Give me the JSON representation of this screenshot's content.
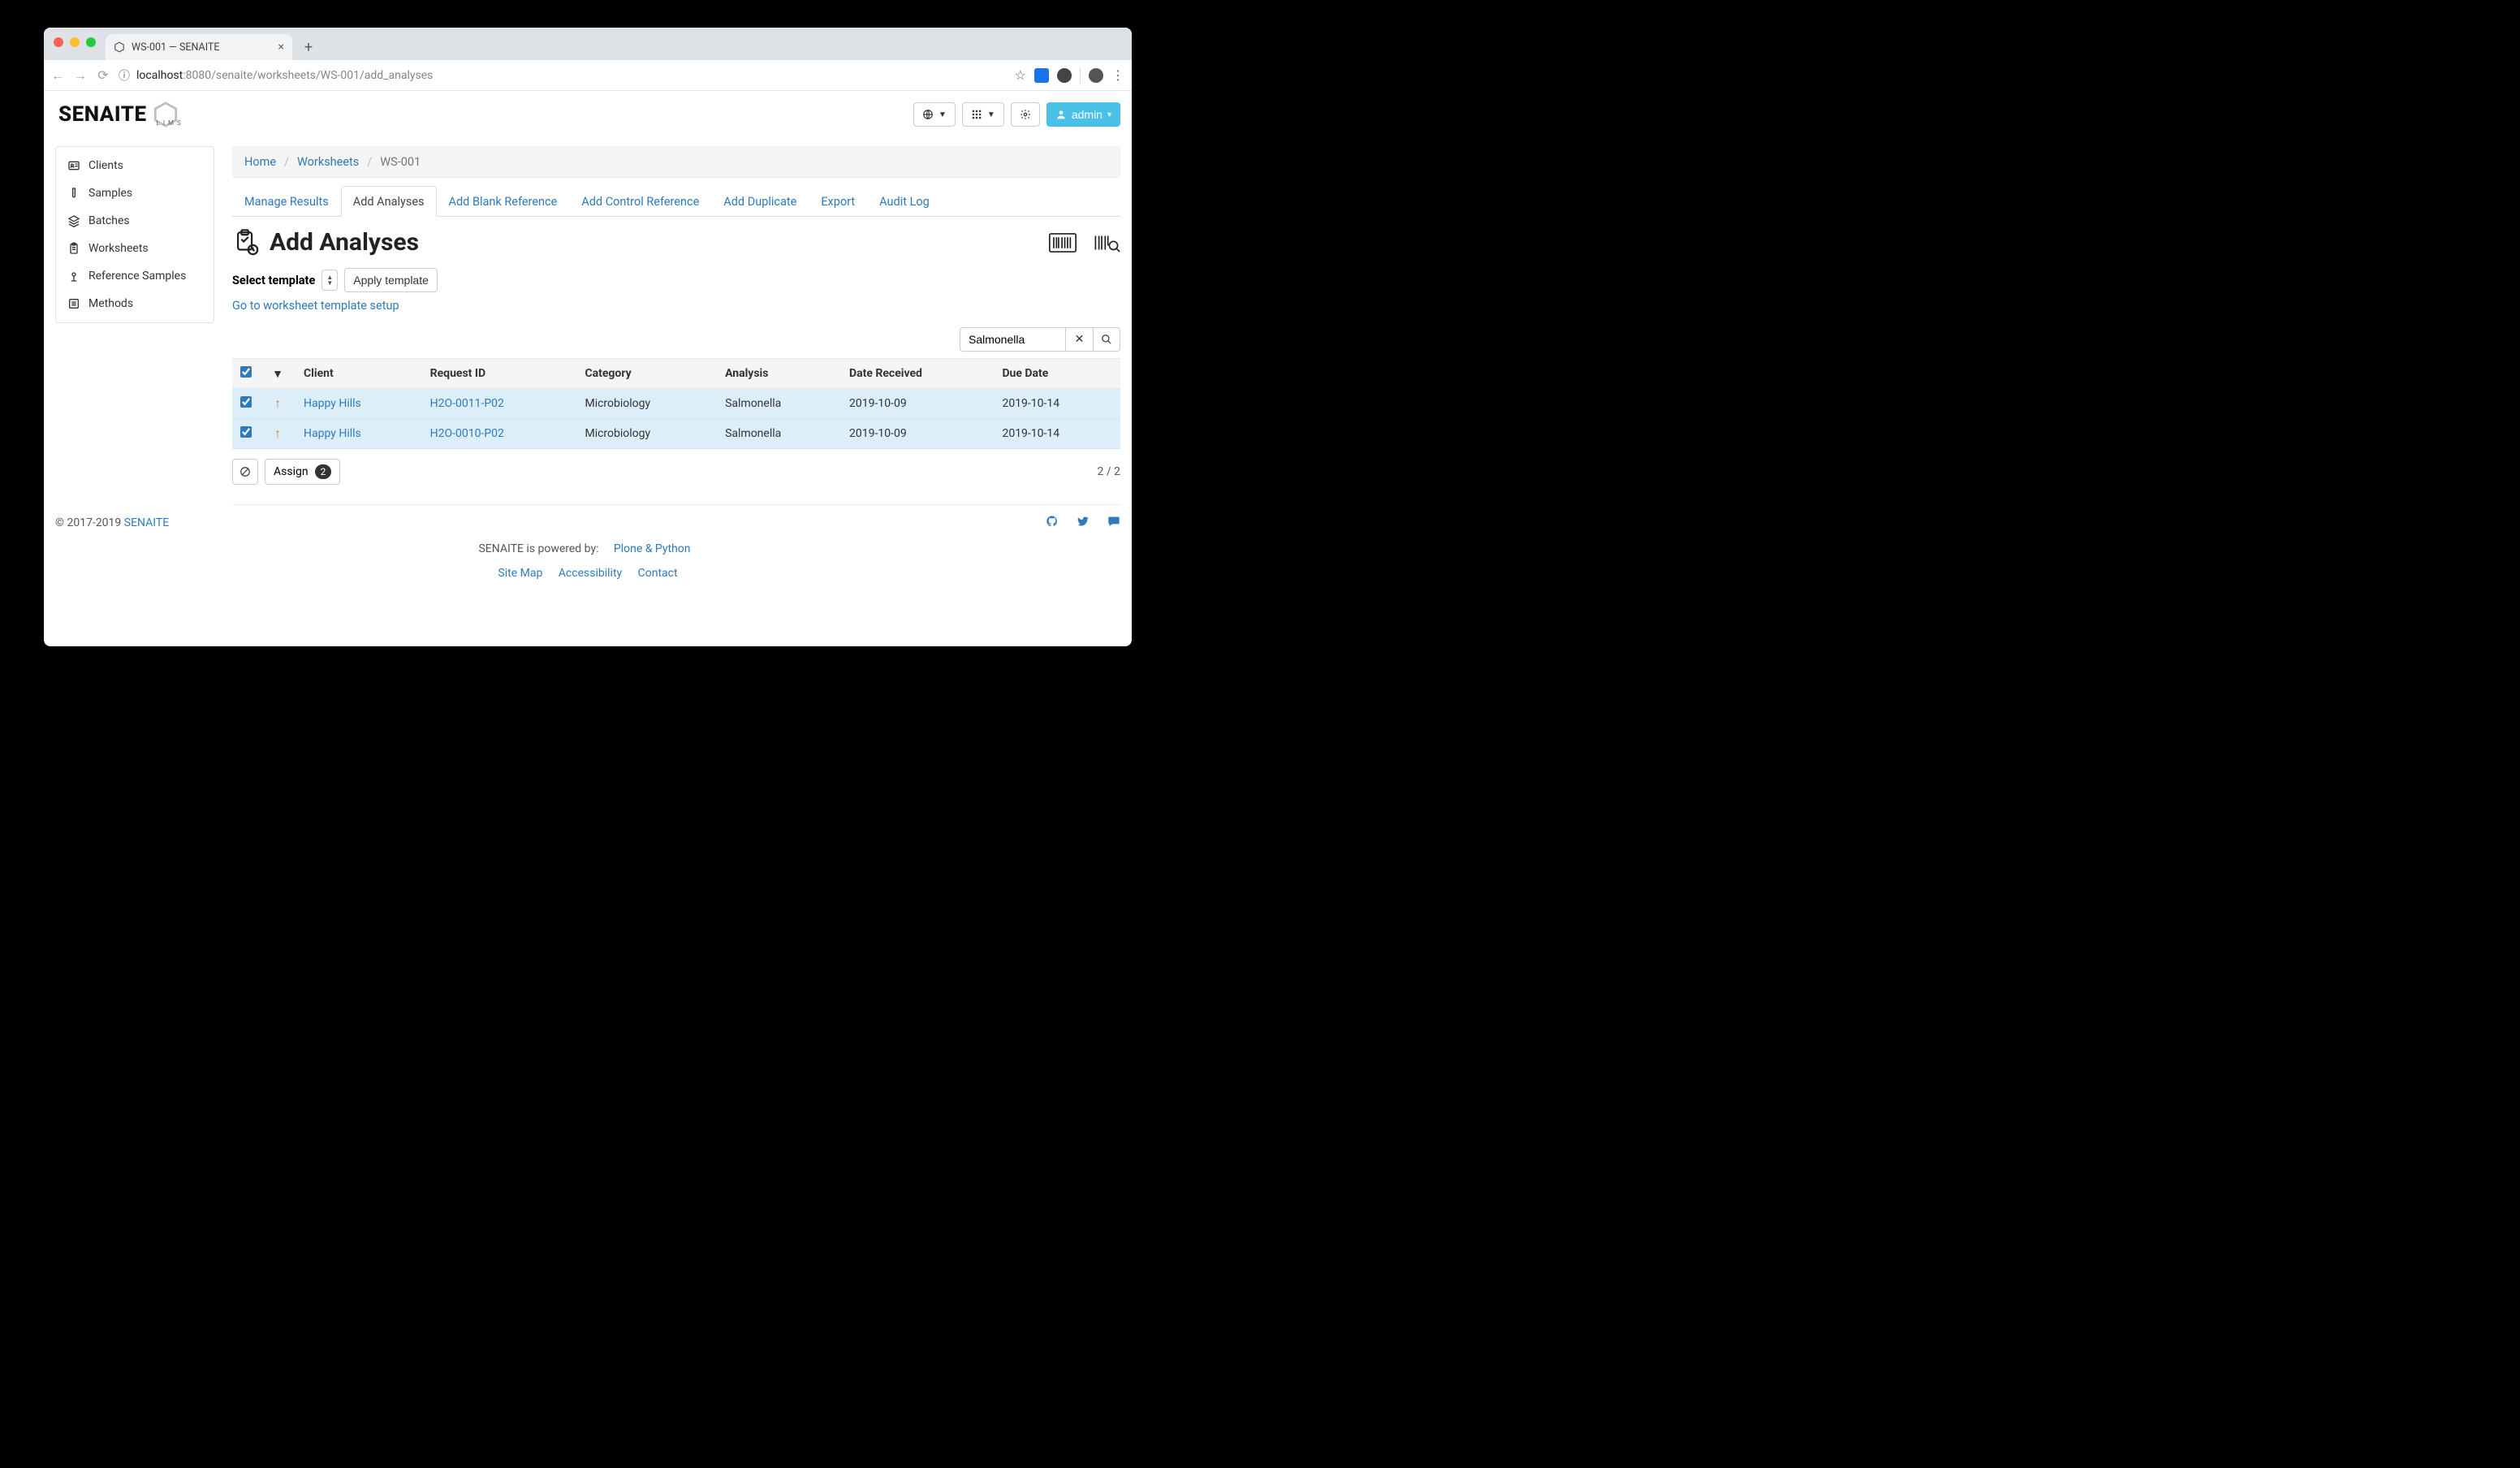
{
  "browser": {
    "tab_title": "WS-001 — SENAITE",
    "url_host": "localhost",
    "url_port": ":8080",
    "url_path": "/senaite/worksheets/WS-001/add_analyses"
  },
  "app": {
    "logo_main": "SENAITE",
    "logo_sub": "LIMS",
    "admin_label": "admin"
  },
  "sidenav": {
    "clients": "Clients",
    "samples": "Samples",
    "batches": "Batches",
    "worksheets": "Worksheets",
    "reference": "Reference Samples",
    "methods": "Methods"
  },
  "breadcrumb": {
    "home": "Home",
    "worksheets": "Worksheets",
    "current": "WS-001"
  },
  "tabs": {
    "manage": "Manage Results",
    "add": "Add Analyses",
    "blank": "Add Blank Reference",
    "control": "Add Control Reference",
    "dup": "Add Duplicate",
    "export": "Export",
    "audit": "Audit Log"
  },
  "page_title": "Add Analyses",
  "template": {
    "label": "Select template",
    "apply": "Apply template",
    "setup_link": "Go to worksheet template setup"
  },
  "search": {
    "value": "Salmonella"
  },
  "table": {
    "head": {
      "sort": "▼",
      "client": "Client",
      "request": "Request ID",
      "category": "Category",
      "analysis": "Analysis",
      "received": "Date Received",
      "due": "Due Date"
    },
    "rows": [
      {
        "client": "Happy Hills",
        "request": "H2O-0011-P02",
        "category": "Microbiology",
        "analysis": "Salmonella",
        "received": "2019-10-09",
        "due": "2019-10-14"
      },
      {
        "client": "Happy Hills",
        "request": "H2O-0010-P02",
        "category": "Microbiology",
        "analysis": "Salmonella",
        "received": "2019-10-09",
        "due": "2019-10-14"
      }
    ]
  },
  "actions": {
    "assign": "Assign",
    "assign_count": "2",
    "paging": "2 / 2"
  },
  "footer": {
    "copyright": "© 2017-2019 ",
    "brand": "SENAITE",
    "powered": "SENAITE is powered by:",
    "plone": "Plone & Python",
    "sitemap": "Site Map",
    "access": "Accessibility",
    "contact": "Contact"
  }
}
